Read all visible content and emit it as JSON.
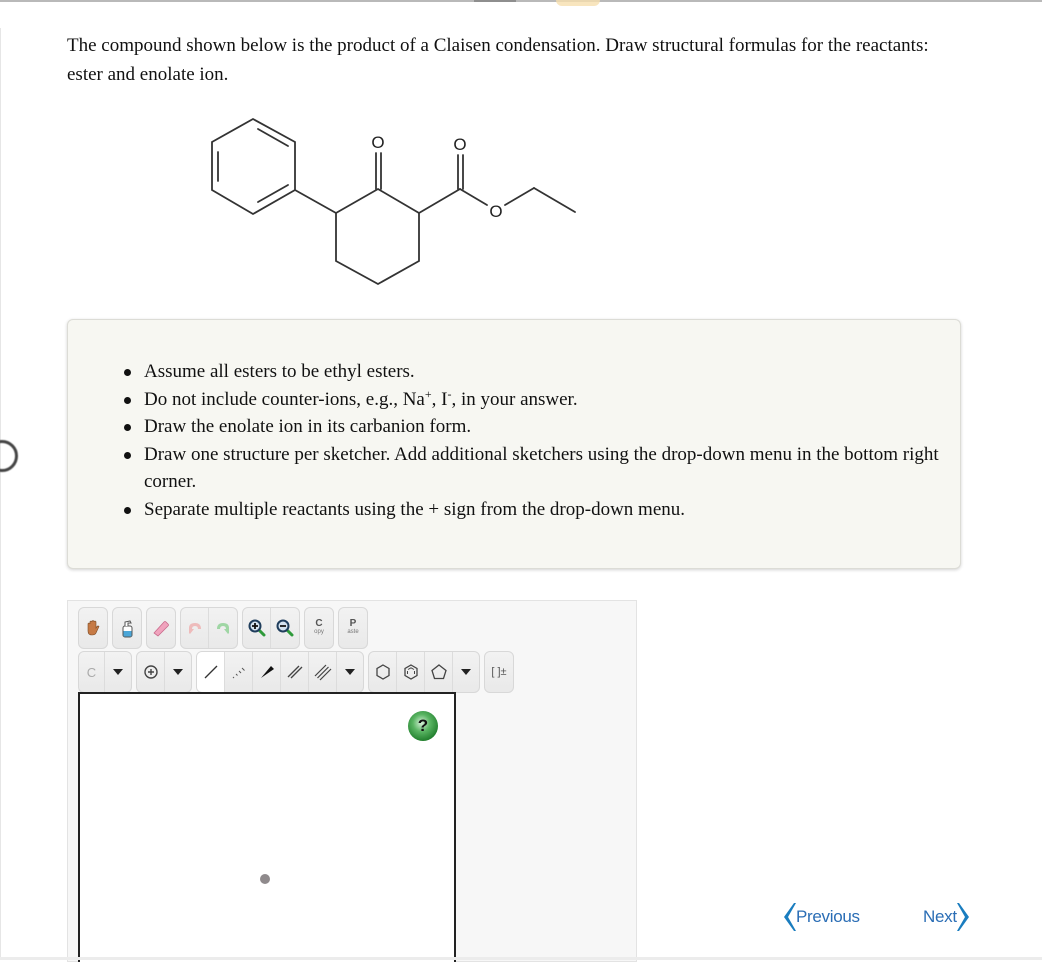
{
  "question": {
    "text": "The compound shown below is the product of a Claisen condensation. Draw structural formulas for the reactants: ester and enolate ion."
  },
  "molecule": {
    "name": "ethyl 2-oxo-3-phenylcyclohexane-1-carboxylate",
    "atom_labels": {
      "ketone_oxygen": "O",
      "carbonyl_oxygen": "O",
      "ester_oxygen": "O"
    }
  },
  "instructions": {
    "items": [
      {
        "text": "Assume all esters to be ethyl esters."
      },
      {
        "pre": "Do not include counter-ions, e.g., Na",
        "sup1": "+",
        "mid": ", I",
        "sup2": "-",
        "post": ", in your answer."
      },
      {
        "text": "Draw the enolate ion in its carbanion form."
      },
      {
        "text": "Draw one structure per sketcher. Add additional sketchers using the drop-down menu in the bottom right corner."
      },
      {
        "text": "Separate multiple reactants using the + sign from the drop-down menu."
      }
    ]
  },
  "sketcher": {
    "toolbar_row1": [
      {
        "name": "move-hand-icon"
      },
      {
        "name": "erase-all-bottle-icon"
      },
      {
        "name": "eraser-icon"
      },
      {
        "name": "undo-icon"
      },
      {
        "name": "redo-icon"
      },
      {
        "name": "zoom-in-icon"
      },
      {
        "name": "zoom-out-icon"
      },
      {
        "name": "copy-button",
        "big": "C",
        "small": "opy"
      },
      {
        "name": "paste-button",
        "big": "P",
        "small": "aste"
      }
    ],
    "atom_selector": "C",
    "charge_label": "[ ]±",
    "help_label": "?",
    "selected_tool": "single-bond"
  },
  "navigation": {
    "previous_label": "Previous",
    "next_label": "Next",
    "color": "#1a7dbf"
  }
}
